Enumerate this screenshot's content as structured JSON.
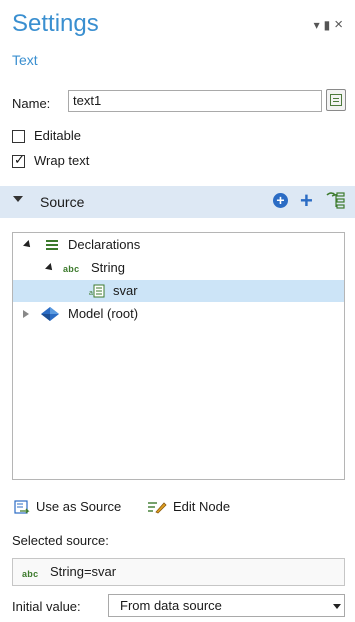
{
  "panel": {
    "title": "Settings",
    "subtitle": "Text",
    "window_controls": [
      "chevron-down",
      "pin",
      "close"
    ]
  },
  "form": {
    "name_label": "Name:",
    "name_value": "text1",
    "editable_label": "Editable",
    "editable_checked": false,
    "wrap_text_label": "Wrap text",
    "wrap_text_checked": true
  },
  "source_section": {
    "title": "Source",
    "expanded": true,
    "toolbar_icons": [
      "add-circle-icon",
      "add-icon",
      "tree-switch-icon"
    ]
  },
  "tree": {
    "items": [
      {
        "label": "Declarations",
        "icon": "declarations-icon",
        "expanded": true
      },
      {
        "label": "String",
        "icon": "abc-icon",
        "expanded": true
      },
      {
        "label": "svar",
        "icon": "string-variable-icon",
        "selected": true
      },
      {
        "label": "Model (root)",
        "icon": "model-icon",
        "expanded": false
      }
    ]
  },
  "actions": {
    "use_as_source": "Use as Source",
    "edit_node": "Edit Node"
  },
  "selected_source": {
    "label": "Selected source:",
    "abc": "abc",
    "value": "String=svar"
  },
  "initial_value": {
    "label": "Initial value:",
    "selected": "From data source"
  },
  "colors": {
    "accent": "#3a8fd0",
    "section_bg": "#dde8f4",
    "selection_bg": "#cce4f7",
    "icon_green": "#3c7a2c",
    "icon_blue": "#2b6cc4"
  }
}
